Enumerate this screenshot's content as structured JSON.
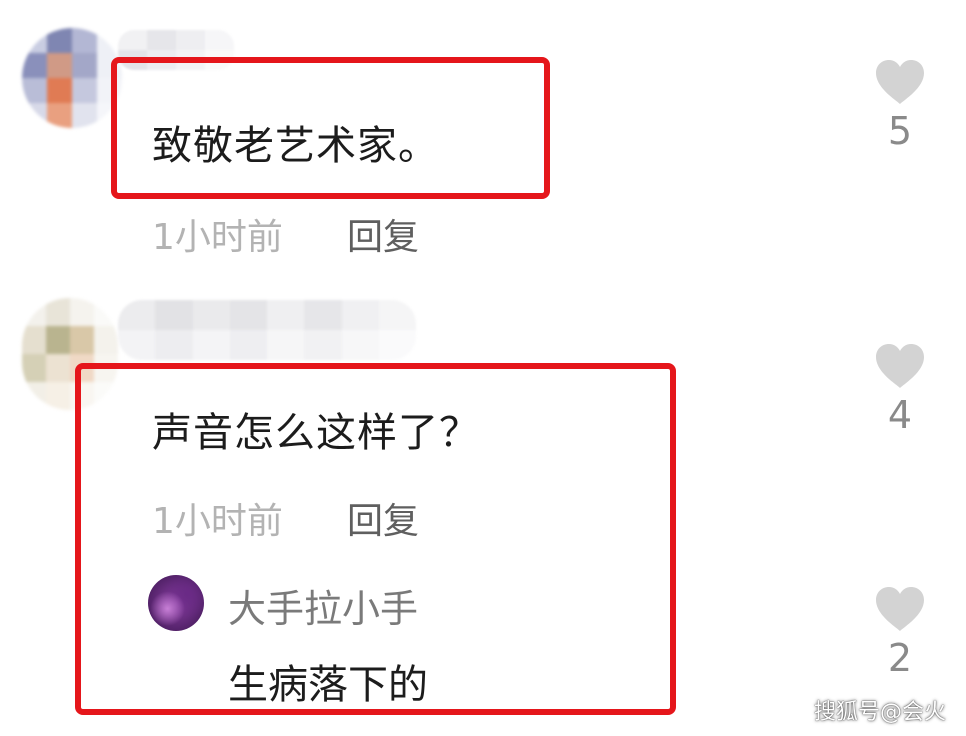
{
  "comments": [
    {
      "text": "致敬老艺术家。",
      "time": "1小时前",
      "reply_label": "回复",
      "likes": "5"
    },
    {
      "text": "声音怎么这样了？",
      "time": "1小时前",
      "reply_label": "回复",
      "likes": "4",
      "sub_reply": {
        "author": "大手拉小手",
        "text": "生病落下的",
        "likes": "2"
      }
    }
  ],
  "watermark": "搜狐号@会火",
  "icons": {
    "like": "heart-icon"
  },
  "colors": {
    "highlight_border": "#e5161b",
    "like_icon": "#d3d3d3"
  }
}
